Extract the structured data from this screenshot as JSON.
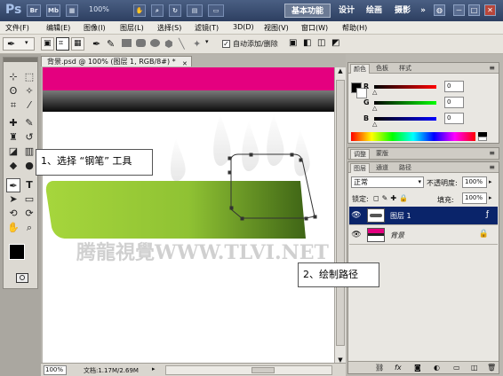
{
  "appbar": {
    "logo": "Ps",
    "bridge_label": "Br",
    "minibridge_label": "Mb",
    "zoom_value": "100%",
    "workspaces": [
      "基本功能",
      "设计",
      "绘画",
      "摄影"
    ],
    "more_label": "»",
    "window_controls": [
      "－",
      "□",
      "✕"
    ]
  },
  "menubar": {
    "items": [
      "文件(F)",
      "编辑(E)",
      "图像(I)",
      "图层(L)",
      "选择(S)",
      "滤镜(T)",
      "3D(D)",
      "视图(V)",
      "窗口(W)",
      "帮助(H)"
    ]
  },
  "options": {
    "auto_add_delete_label": "自动添加/删除",
    "auto_add_delete_checked": true
  },
  "document": {
    "tab_title": "背景.psd @ 100% (图层 1, RGB/8#) *",
    "zoom": "100%",
    "doc_info": "文档:1.17M/2.69M",
    "watermark": "腾龍視覺WWW.TLVI.NET"
  },
  "color_panel": {
    "tabs": [
      "颜色",
      "色板",
      "样式"
    ],
    "channels": [
      {
        "label": "R",
        "value": "0",
        "color": "#d00000"
      },
      {
        "label": "G",
        "value": "0",
        "color": "#00a000"
      },
      {
        "label": "B",
        "value": "0",
        "color": "#0000d0"
      }
    ]
  },
  "adjust_panel": {
    "tabs": [
      "调整",
      "蒙版"
    ]
  },
  "layers_panel": {
    "tabs": [
      "图层",
      "通道",
      "路径"
    ],
    "blend_mode": "正常",
    "opacity_label": "不透明度:",
    "opacity_value": "100%",
    "lock_label": "锁定:",
    "fill_label": "填充:",
    "fill_value": "100%",
    "layers": [
      {
        "name": "图层 1",
        "selected": true,
        "badge": "fx"
      },
      {
        "name": "背景",
        "selected": false,
        "badge": "lock"
      }
    ]
  },
  "callouts": {
    "step1": "1、选择 “钢笔” 工具",
    "step2": "2、绘制路径"
  },
  "colors": {
    "magenta_band": "#e4007f",
    "green_start": "#a6d63c",
    "green_end": "#3f6516",
    "selected_layer": "#0a246a"
  }
}
